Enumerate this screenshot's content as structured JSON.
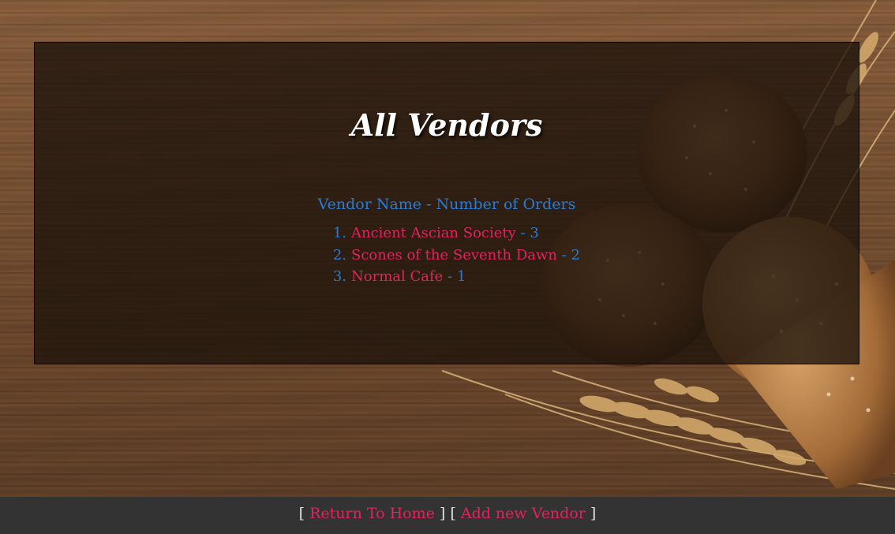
{
  "page": {
    "title": "All Vendors"
  },
  "vendors": {
    "header": "Vendor Name - Number of Orders",
    "separator": " - ",
    "items": [
      {
        "index": "1.",
        "name": "Ancient Ascian Society",
        "orders": "3"
      },
      {
        "index": "2.",
        "name": "Scones of the Seventh Dawn",
        "orders": "2"
      },
      {
        "index": "3.",
        "name": "Normal Cafe",
        "orders": "1"
      }
    ]
  },
  "footer": {
    "open_bracket": "[",
    "close_bracket": "]",
    "home_link": "Return To Home",
    "add_link": "Add new Vendor"
  },
  "colors": {
    "link": "#e0245e",
    "header_blue": "#2b7bd3",
    "footer_bg": "#333333"
  }
}
